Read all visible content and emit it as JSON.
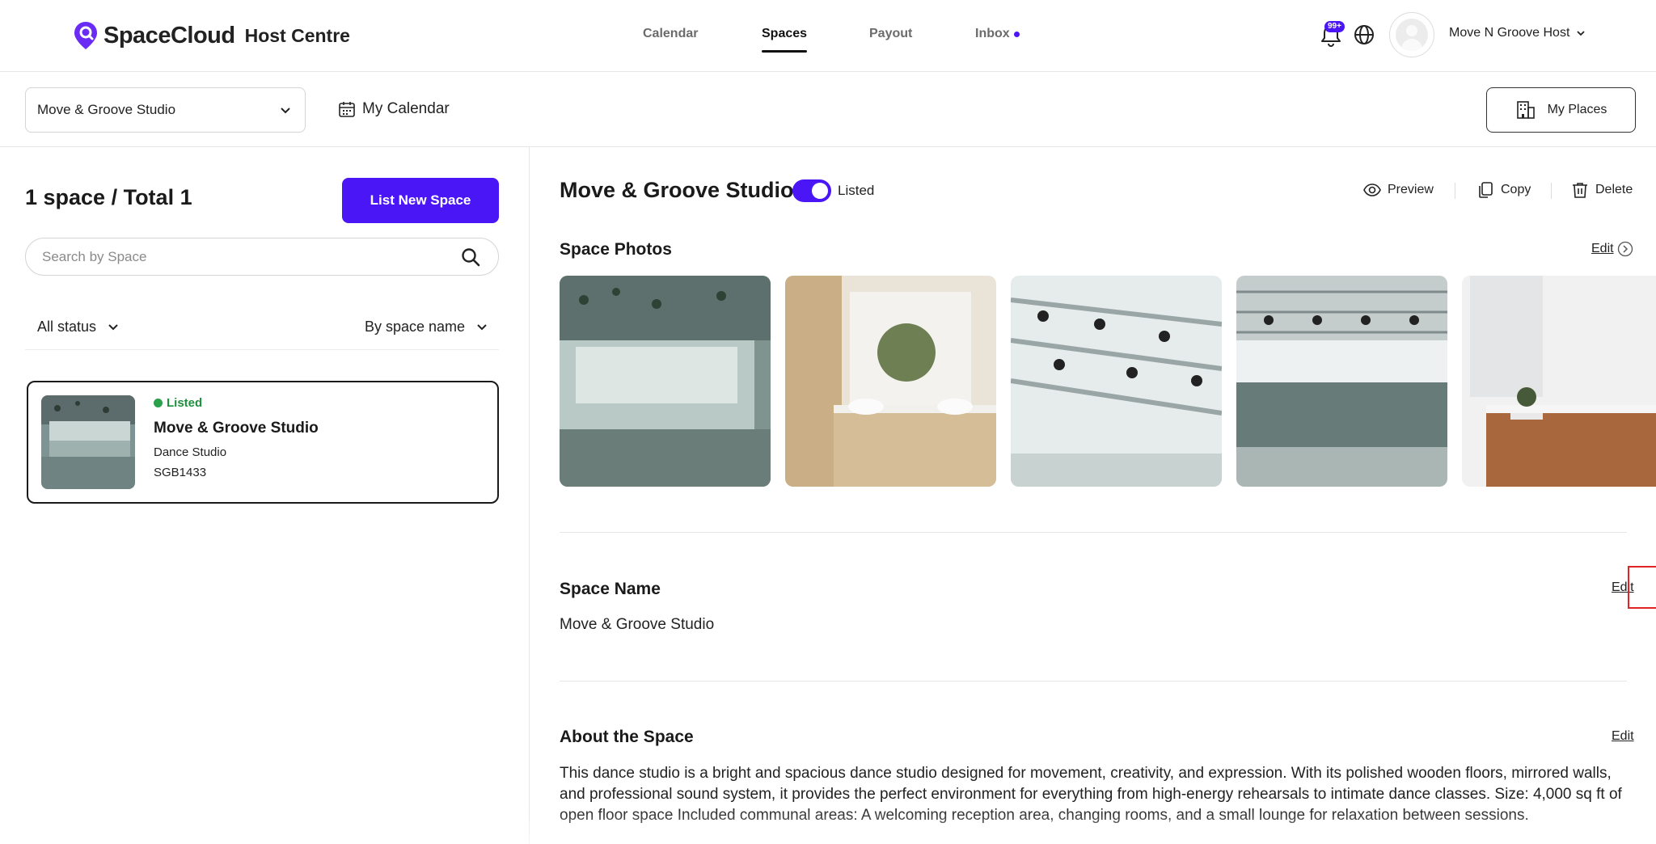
{
  "brand": {
    "name": "SpaceCloud",
    "sub": "Host Centre"
  },
  "nav": {
    "calendar": "Calendar",
    "spaces": "Spaces",
    "payout": "Payout",
    "inbox": "Inbox"
  },
  "notifications": {
    "badge": "99+"
  },
  "user": {
    "name": "Move N Groove Host"
  },
  "subheader": {
    "studio_select": "Move & Groove Studio",
    "my_calendar": "My Calendar",
    "my_places": "My Places"
  },
  "left": {
    "count_title": "1 space / Total 1",
    "list_new": "List New Space",
    "search_placeholder": "Search by Space",
    "filter_status": "All status",
    "filter_sort": "By space name",
    "card": {
      "status": "Listed",
      "name": "Move & Groove Studio",
      "type": "Dance Studio",
      "code": "SGB1433"
    }
  },
  "right": {
    "title": "Move & Groove Studio",
    "toggle_label": "Listed",
    "listed": true,
    "actions": {
      "preview": "Preview",
      "copy": "Copy",
      "delete": "Delete"
    },
    "photos_heading": "Space Photos",
    "photos_edit": "Edit",
    "name_heading": "Space Name",
    "name_edit": "Edit",
    "name_value": "Move & Groove Studio",
    "about_heading": "About the Space",
    "about_edit": "Edit",
    "about_text": "This dance studio is a bright and spacious dance studio designed for movement, creativity, and expression. With its polished wooden floors, mirrored walls, and professional sound system, it provides the perfect environment for everything from high-energy rehearsals to intimate dance classes. Size: 4,000 sq ft of open floor space Included communal areas: A welcoming reception area, changing rooms, and a small lounge for relaxation between sessions."
  },
  "colors": {
    "accent": "#4b16f5",
    "listed_green": "#2aa14a",
    "highlight": "#e02424"
  }
}
